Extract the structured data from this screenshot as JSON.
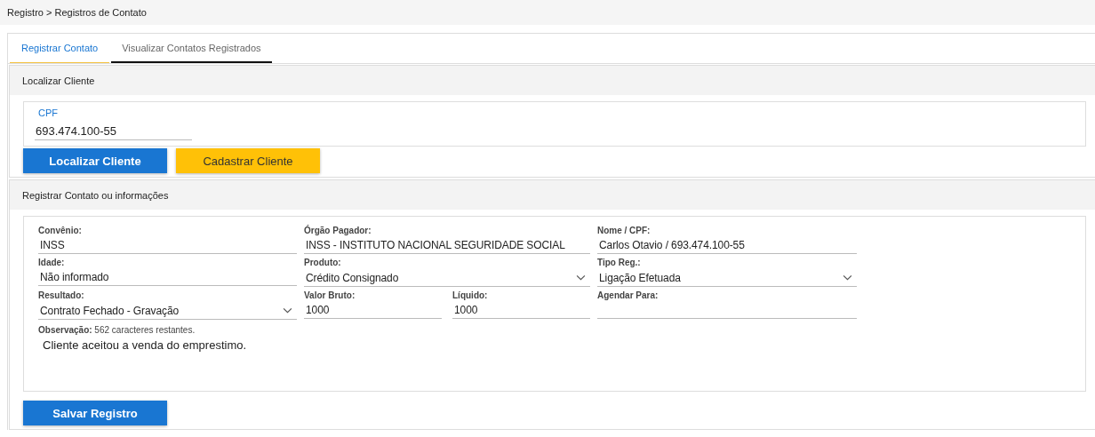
{
  "breadcrumb": "Registro > Registros de Contato",
  "tabs": [
    {
      "label": "Registrar Contato",
      "selected": true
    },
    {
      "label": "Visualizar Contatos Registrados",
      "selected": false
    }
  ],
  "locate": {
    "title": "Localizar Cliente",
    "cpf": {
      "label": "CPF",
      "value": "693.474.100-55"
    },
    "buttons": [
      {
        "label": "Localizar Cliente",
        "kind": "primary"
      },
      {
        "label": "Cadastrar Cliente",
        "kind": "warning"
      }
    ]
  },
  "register": {
    "title": "Registrar Contato ou informações",
    "rows": [
      [
        {
          "kind": "text",
          "label": "Convênio:",
          "value": "INSS"
        },
        {
          "kind": "text",
          "label": "Órgão Pagador:",
          "value": "INSS - INSTITUTO NACIONAL SEGURIDADE SOCIAL"
        },
        {
          "kind": "text",
          "label": "Nome / CPF:",
          "value": "Carlos Otavio / 693.474.100-55"
        }
      ],
      [
        {
          "kind": "text",
          "label": "Idade:",
          "value": "Não informado"
        },
        {
          "kind": "select",
          "label": "Produto:",
          "value": "Crédito Consignado"
        },
        {
          "kind": "select",
          "label": "Tipo Reg.:",
          "value": "Ligação Efetuada"
        }
      ],
      [
        {
          "kind": "select",
          "label": "Resultado:",
          "value": "Contrato Fechado - Gravação"
        },
        {
          "kind": "pair",
          "fields": [
            {
              "kind": "text",
              "label": "Valor Bruto:",
              "value": "1000"
            },
            {
              "kind": "text",
              "label": "Líquido:",
              "value": "1000"
            }
          ]
        },
        {
          "kind": "text",
          "label": "Agendar Para:"
        }
      ]
    ],
    "observation": {
      "label": "**Observação:** 562 caracteres restantes.",
      "value": "Cliente aceitou a venda do emprestimo."
    },
    "save_button": "Salvar Registro"
  }
}
